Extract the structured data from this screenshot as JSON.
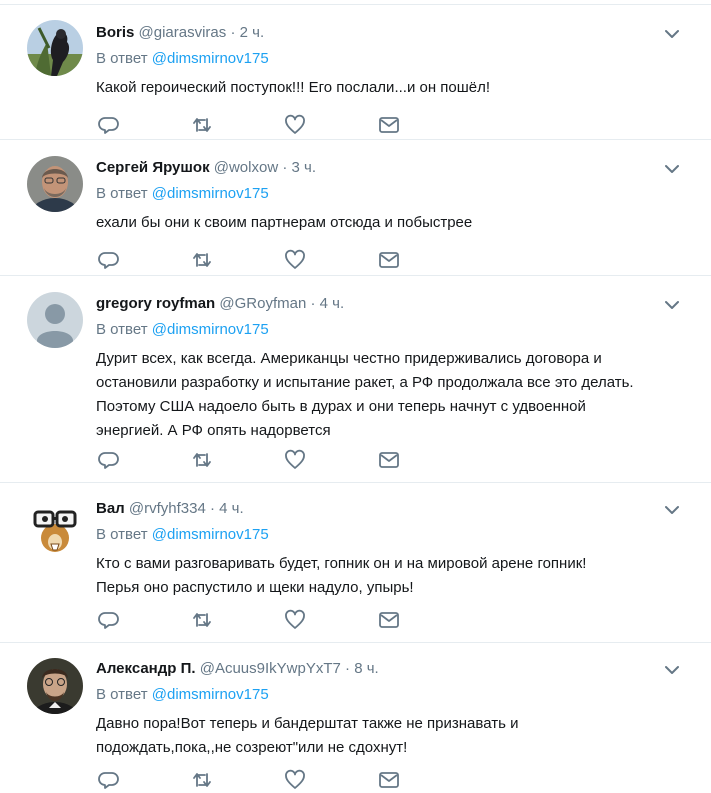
{
  "replies": [
    {
      "name": "Boris",
      "handle": "@giarasviras",
      "dot": "·",
      "time": "2 ч.",
      "reply_prefix": "В ответ",
      "reply_mention": "@dimsmirnov175",
      "text": "Какой героический поступок!!! Его послали...и он пошёл!",
      "avatar": "avatar-boris"
    },
    {
      "name": "Сергей Ярушок",
      "handle": "@wolxow",
      "dot": "·",
      "time": "3 ч.",
      "reply_prefix": "В ответ",
      "reply_mention": "@dimsmirnov175",
      "text": "ехали бы они к своим партнерам отсюда и побыстрее",
      "avatar": "avatar-sergey"
    },
    {
      "name": "gregory royfman",
      "handle": "@GRoyfman",
      "dot": "·",
      "time": "4 ч.",
      "reply_prefix": "В ответ",
      "reply_mention": "@dimsmirnov175",
      "text": "Дурит всех, как всегда. Американцы честно придерживались договора и\nостановили разработку и испытание ракет, а РФ продолжала все это делать.\nПоэтому США надоело быть в дурах и они теперь начнут с удвоенной\nэнергией. А РФ опять надорвется",
      "avatar": "avatar-default"
    },
    {
      "name": "Вал",
      "handle": "@rvfyhf334",
      "dot": "·",
      "time": "4 ч.",
      "reply_prefix": "В ответ",
      "reply_mention": "@dimsmirnov175",
      "text": "Кто с вами разговаривать будет, гопник он и на мировой арене гопник!\nПерья оно распустило и щеки надуло, упырь!",
      "avatar": "avatar-val"
    },
    {
      "name": "Александр П.",
      "handle": "@Acuus9IkYwpYxT7",
      "dot": "·",
      "time": "8 ч.",
      "reply_prefix": "В ответ",
      "reply_mention": "@dimsmirnov175",
      "text": "Давно пора!Вот теперь и бандерштат также не признавать и\nподождать,пока,,не созреют\"или не сдохнут!",
      "avatar": "avatar-alexander"
    }
  ],
  "icons": {
    "more": "chevron-down-icon",
    "reply": "reply-icon",
    "retweet": "retweet-icon",
    "like": "heart-icon",
    "message": "envelope-icon"
  },
  "colors": {
    "text": "#14171a",
    "secondary": "#657786",
    "link": "#1da1f2",
    "divider": "#e6ecf0"
  }
}
